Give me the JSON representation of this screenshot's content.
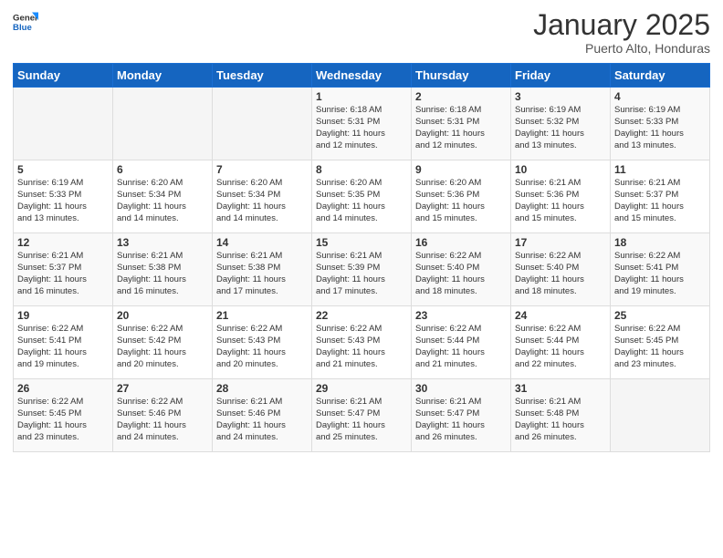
{
  "header": {
    "logo_general": "General",
    "logo_blue": "Blue",
    "month_title": "January 2025",
    "location": "Puerto Alto, Honduras"
  },
  "weekdays": [
    "Sunday",
    "Monday",
    "Tuesday",
    "Wednesday",
    "Thursday",
    "Friday",
    "Saturday"
  ],
  "weeks": [
    [
      {
        "day": "",
        "info": ""
      },
      {
        "day": "",
        "info": ""
      },
      {
        "day": "",
        "info": ""
      },
      {
        "day": "1",
        "info": "Sunrise: 6:18 AM\nSunset: 5:31 PM\nDaylight: 11 hours\nand 12 minutes."
      },
      {
        "day": "2",
        "info": "Sunrise: 6:18 AM\nSunset: 5:31 PM\nDaylight: 11 hours\nand 12 minutes."
      },
      {
        "day": "3",
        "info": "Sunrise: 6:19 AM\nSunset: 5:32 PM\nDaylight: 11 hours\nand 13 minutes."
      },
      {
        "day": "4",
        "info": "Sunrise: 6:19 AM\nSunset: 5:33 PM\nDaylight: 11 hours\nand 13 minutes."
      }
    ],
    [
      {
        "day": "5",
        "info": "Sunrise: 6:19 AM\nSunset: 5:33 PM\nDaylight: 11 hours\nand 13 minutes."
      },
      {
        "day": "6",
        "info": "Sunrise: 6:20 AM\nSunset: 5:34 PM\nDaylight: 11 hours\nand 14 minutes."
      },
      {
        "day": "7",
        "info": "Sunrise: 6:20 AM\nSunset: 5:34 PM\nDaylight: 11 hours\nand 14 minutes."
      },
      {
        "day": "8",
        "info": "Sunrise: 6:20 AM\nSunset: 5:35 PM\nDaylight: 11 hours\nand 14 minutes."
      },
      {
        "day": "9",
        "info": "Sunrise: 6:20 AM\nSunset: 5:36 PM\nDaylight: 11 hours\nand 15 minutes."
      },
      {
        "day": "10",
        "info": "Sunrise: 6:21 AM\nSunset: 5:36 PM\nDaylight: 11 hours\nand 15 minutes."
      },
      {
        "day": "11",
        "info": "Sunrise: 6:21 AM\nSunset: 5:37 PM\nDaylight: 11 hours\nand 15 minutes."
      }
    ],
    [
      {
        "day": "12",
        "info": "Sunrise: 6:21 AM\nSunset: 5:37 PM\nDaylight: 11 hours\nand 16 minutes."
      },
      {
        "day": "13",
        "info": "Sunrise: 6:21 AM\nSunset: 5:38 PM\nDaylight: 11 hours\nand 16 minutes."
      },
      {
        "day": "14",
        "info": "Sunrise: 6:21 AM\nSunset: 5:38 PM\nDaylight: 11 hours\nand 17 minutes."
      },
      {
        "day": "15",
        "info": "Sunrise: 6:21 AM\nSunset: 5:39 PM\nDaylight: 11 hours\nand 17 minutes."
      },
      {
        "day": "16",
        "info": "Sunrise: 6:22 AM\nSunset: 5:40 PM\nDaylight: 11 hours\nand 18 minutes."
      },
      {
        "day": "17",
        "info": "Sunrise: 6:22 AM\nSunset: 5:40 PM\nDaylight: 11 hours\nand 18 minutes."
      },
      {
        "day": "18",
        "info": "Sunrise: 6:22 AM\nSunset: 5:41 PM\nDaylight: 11 hours\nand 19 minutes."
      }
    ],
    [
      {
        "day": "19",
        "info": "Sunrise: 6:22 AM\nSunset: 5:41 PM\nDaylight: 11 hours\nand 19 minutes."
      },
      {
        "day": "20",
        "info": "Sunrise: 6:22 AM\nSunset: 5:42 PM\nDaylight: 11 hours\nand 20 minutes."
      },
      {
        "day": "21",
        "info": "Sunrise: 6:22 AM\nSunset: 5:43 PM\nDaylight: 11 hours\nand 20 minutes."
      },
      {
        "day": "22",
        "info": "Sunrise: 6:22 AM\nSunset: 5:43 PM\nDaylight: 11 hours\nand 21 minutes."
      },
      {
        "day": "23",
        "info": "Sunrise: 6:22 AM\nSunset: 5:44 PM\nDaylight: 11 hours\nand 21 minutes."
      },
      {
        "day": "24",
        "info": "Sunrise: 6:22 AM\nSunset: 5:44 PM\nDaylight: 11 hours\nand 22 minutes."
      },
      {
        "day": "25",
        "info": "Sunrise: 6:22 AM\nSunset: 5:45 PM\nDaylight: 11 hours\nand 23 minutes."
      }
    ],
    [
      {
        "day": "26",
        "info": "Sunrise: 6:22 AM\nSunset: 5:45 PM\nDaylight: 11 hours\nand 23 minutes."
      },
      {
        "day": "27",
        "info": "Sunrise: 6:22 AM\nSunset: 5:46 PM\nDaylight: 11 hours\nand 24 minutes."
      },
      {
        "day": "28",
        "info": "Sunrise: 6:21 AM\nSunset: 5:46 PM\nDaylight: 11 hours\nand 24 minutes."
      },
      {
        "day": "29",
        "info": "Sunrise: 6:21 AM\nSunset: 5:47 PM\nDaylight: 11 hours\nand 25 minutes."
      },
      {
        "day": "30",
        "info": "Sunrise: 6:21 AM\nSunset: 5:47 PM\nDaylight: 11 hours\nand 26 minutes."
      },
      {
        "day": "31",
        "info": "Sunrise: 6:21 AM\nSunset: 5:48 PM\nDaylight: 11 hours\nand 26 minutes."
      },
      {
        "day": "",
        "info": ""
      }
    ]
  ]
}
